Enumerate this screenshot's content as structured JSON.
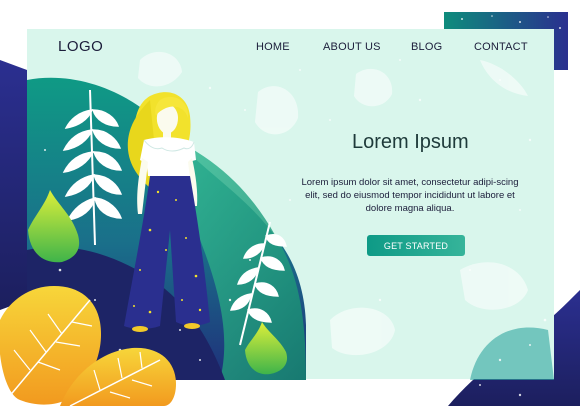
{
  "nav": {
    "logo": "LOGO",
    "items": [
      "HOME",
      "ABOUT US",
      "BLOG",
      "CONTACT"
    ]
  },
  "hero": {
    "title": "Lorem Ipsum",
    "body": "Lorem ipsum dolor sit amet, consectetur adipi-scing elit, sed do eiusmod tempor incididunt ut labore et dolore magna aliqua.",
    "cta_label": "GET STARTED"
  },
  "colors": {
    "panel": "#d9f6ec",
    "navy": "#2a2f8f",
    "teal": "#0e9a86",
    "green": "#36b49a",
    "yellow": "#f2c92a",
    "orange": "#f4a322",
    "text": "#1b1d3a"
  },
  "icons": [
    "fern-leaf-icon",
    "monstera-leaf-icon",
    "autumn-leaf-icon",
    "hair-silhouette"
  ]
}
